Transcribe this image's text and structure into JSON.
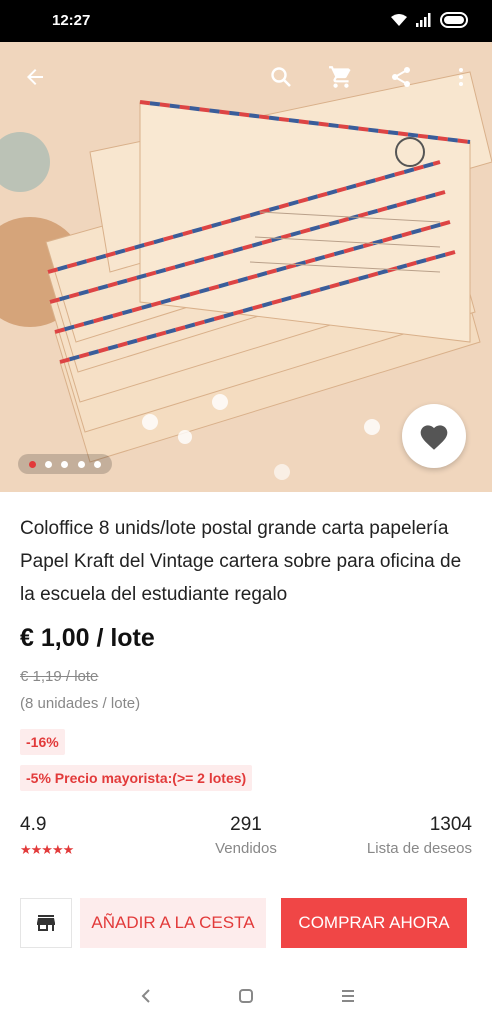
{
  "status_bar": {
    "time": "12:27"
  },
  "product": {
    "title": "Coloffice 8 unids/lote postal grande carta papelería Papel Kraft del Vintage cartera sobre para oficina de la escuela del estudiante regalo",
    "price": "€ 1,00 / lote",
    "old_price": "€ 1,19 / lote",
    "units": "(8 unidades / lote)",
    "discount_badge": "-16%",
    "wholesale_badge": "-5% Precio mayorista:(>= 2 lotes)",
    "image_dots": {
      "count": 5,
      "active_index": 0
    }
  },
  "stats": {
    "rating": "4.9",
    "stars": "★★★★★",
    "sold_value": "291",
    "sold_label": "Vendidos",
    "wishlist_value": "1304",
    "wishlist_label": "Lista de deseos"
  },
  "actions": {
    "add_to_cart": "AÑADIR A LA CESTA",
    "buy_now": "COMPRAR AHORA"
  },
  "colors": {
    "accent": "#f04646",
    "accent_light": "#fdecec"
  },
  "icons": [
    "back-arrow-icon",
    "search-icon",
    "cart-icon",
    "share-icon",
    "more-vert-icon",
    "heart-icon",
    "store-icon",
    "nav-back-icon",
    "nav-home-icon",
    "nav-recents-icon",
    "wifi-icon",
    "signal-icon",
    "battery-icon"
  ]
}
